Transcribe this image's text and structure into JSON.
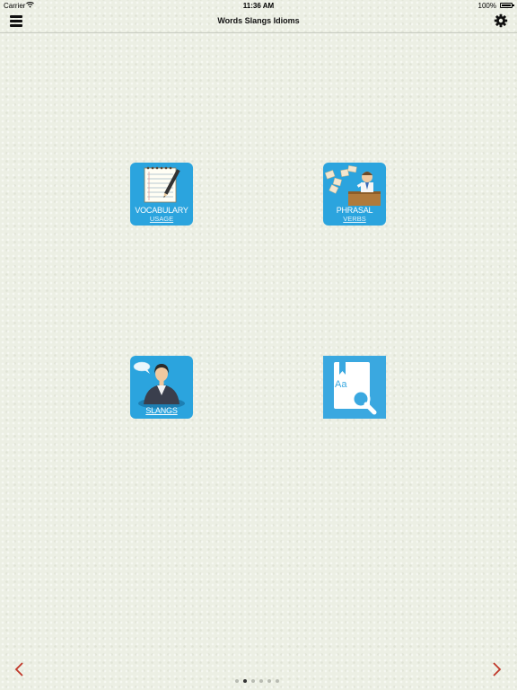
{
  "status_bar": {
    "carrier": "Carrier",
    "time": "11:36 AM",
    "battery": "100%"
  },
  "nav_bar": {
    "title": "Words Slangs Idioms",
    "left_icon": "hamburger-menu-icon",
    "right_icon": "gear-icon"
  },
  "tiles": [
    {
      "label": "VOCABULARY",
      "sublabel": "USAGE",
      "icon": "notepad-pencil-icon"
    },
    {
      "label": "PHRASAL",
      "sublabel": "VERBS",
      "icon": "office-worker-icon"
    },
    {
      "label": "SLANGS",
      "icon": "woman-speech-bubble-icon"
    },
    {
      "text": "Aa",
      "icon": "dictionary-search-icon"
    }
  ],
  "pagination": {
    "total": 6,
    "active_index": 1
  },
  "colors": {
    "tile_blue": "#2ba4de",
    "arrow_red": "#c0392b",
    "background": "#ecefe4"
  }
}
